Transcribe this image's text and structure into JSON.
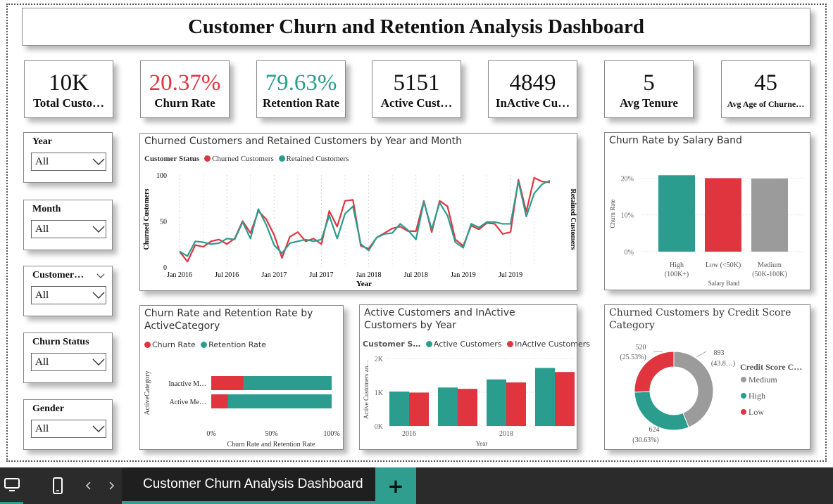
{
  "title": "Customer Churn and Retention Analysis Dashboard",
  "colors": {
    "churn": "#e0343f",
    "retention": "#2a9d8f",
    "gray": "#9b9b9b",
    "text": "#111111"
  },
  "kpis": [
    {
      "value": "10K",
      "label": "Total Custo…",
      "value_color": "#111111"
    },
    {
      "value": "20.37%",
      "label": "Churn Rate",
      "value_color": "#e0343f"
    },
    {
      "value": "79.63%",
      "label": "Retention Rate",
      "value_color": "#2a9d8f"
    },
    {
      "value": "5151",
      "label": "Active Cust…",
      "value_color": "#111111"
    },
    {
      "value": "4849",
      "label": "InActive Cu…",
      "value_color": "#111111"
    },
    {
      "value": "5",
      "label": "Avg Tenure",
      "value_color": "#111111"
    },
    {
      "value": "45",
      "label": "Avg Age of Churne…",
      "value_color": "#111111"
    }
  ],
  "slicers": [
    {
      "title": "Year",
      "value": "All"
    },
    {
      "title": "Month",
      "value": "All"
    },
    {
      "title": "Customer…",
      "value": "All"
    },
    {
      "title": "Churn Status",
      "value": "All"
    },
    {
      "title": "Gender",
      "value": "All"
    }
  ],
  "line_chart": {
    "title": "Churned Customers and Retained Customers by Year and Month",
    "legend_title": "Customer Status",
    "y_left_label": "Churned Customers",
    "y_right_label": "Retained Customers",
    "x_title": "Year",
    "y_ticks": [
      "100",
      "50",
      "0"
    ],
    "x_ticks": [
      "Jan 2016",
      "Jul 2016",
      "Jan 2017",
      "Jul 2017",
      "Jan 2018",
      "Jul 2018",
      "Jan 2019",
      "Jul 2019"
    ]
  },
  "salary_chart": {
    "title": "Churn Rate by Salary Band",
    "ylabel": "Churn Rate",
    "xlabel": "Salary Band",
    "y_ticks": [
      "20%",
      "10%",
      "0%"
    ],
    "cat_lines": [
      [
        "High",
        "(100K+)"
      ],
      [
        "Low (<50K)",
        ""
      ],
      [
        "Medium",
        "(50K-100K)"
      ]
    ]
  },
  "active_chart": {
    "title_line1": "Churn Rate and Retention Rate by",
    "title_line2": "ActiveCategory",
    "ylabel": "ActiveCategory",
    "xlabel": "Churn Rate and Retention Rate",
    "cat_labels": [
      "Inactive M…",
      "Active Me…"
    ],
    "x_ticks": [
      "0%",
      "50%",
      "100%"
    ]
  },
  "year_chart": {
    "title_line1": "Active Customers and InActive",
    "title_line2": "Customers by Year",
    "legend_title": "Customer S…",
    "ylabel": "Active Customers an…",
    "xlabel": "Year",
    "y_ticks": [
      "2K",
      "1K",
      "0K"
    ],
    "x_ticks": [
      "2016",
      "2018"
    ]
  },
  "donut_chart": {
    "title_line1": "Churned Customers by Credit Score",
    "title_line2": "Category",
    "legend_title": "Credit Score C…",
    "labels": {
      "low_count": "520",
      "low_pct": "(25.53%)",
      "med_count": "893",
      "med_pct": "(43.8…)",
      "high_count": "624",
      "high_pct": "(30.63%)"
    }
  },
  "chart_data": [
    {
      "type": "line",
      "title": "Churned Customers and Retained Customers by Year and Month",
      "xlabel": "Year",
      "ylabel": "Churned Customers",
      "ylim": [
        0,
        100
      ],
      "x": [
        "2016-01",
        "2016-02",
        "2016-03",
        "2016-04",
        "2016-05",
        "2016-06",
        "2016-07",
        "2016-08",
        "2016-09",
        "2016-10",
        "2016-11",
        "2016-12",
        "2017-01",
        "2017-02",
        "2017-03",
        "2017-04",
        "2017-05",
        "2017-06",
        "2017-07",
        "2017-08",
        "2017-09",
        "2017-10",
        "2017-11",
        "2017-12",
        "2018-01",
        "2018-02",
        "2018-03",
        "2018-04",
        "2018-05",
        "2018-06",
        "2018-07",
        "2018-08",
        "2018-09",
        "2018-10",
        "2018-11",
        "2018-12",
        "2019-01",
        "2019-02",
        "2019-03",
        "2019-04",
        "2019-05",
        "2019-06",
        "2019-07",
        "2019-08",
        "2019-09",
        "2019-10",
        "2019-11",
        "2019-12"
      ],
      "series": [
        {
          "name": "Churned Customers",
          "color": "#e0343f",
          "values": [
            17,
            6,
            24,
            22,
            28,
            30,
            25,
            31,
            50,
            37,
            61,
            52,
            35,
            10,
            33,
            38,
            28,
            31,
            25,
            61,
            44,
            72,
            73,
            23,
            20,
            32,
            37,
            42,
            44,
            39,
            39,
            72,
            38,
            72,
            66,
            30,
            23,
            45,
            41,
            48,
            47,
            36,
            38,
            95,
            60,
            97,
            93,
            92
          ]
        },
        {
          "name": "Retained Customers",
          "color": "#2a9d8f",
          "values": [
            17,
            12,
            28,
            27,
            25,
            26,
            31,
            30,
            49,
            31,
            63,
            46,
            24,
            15,
            26,
            28,
            30,
            28,
            30,
            56,
            31,
            58,
            66,
            25,
            18,
            32,
            36,
            37,
            47,
            40,
            30,
            71,
            41,
            70,
            56,
            27,
            21,
            47,
            43,
            49,
            49,
            47,
            47,
            93,
            55,
            80,
            90,
            94
          ]
        }
      ]
    },
    {
      "type": "bar",
      "title": "Churn Rate by Salary Band",
      "xlabel": "Salary Band",
      "ylabel": "Churn Rate",
      "ylim": [
        0,
        0.22
      ],
      "categories": [
        "High (100K+)",
        "Low (<50K)",
        "Medium (50K-100K)"
      ],
      "values": [
        0.208,
        0.2,
        0.199
      ],
      "colors": [
        "#2a9d8f",
        "#e0343f",
        "#9b9b9b"
      ]
    },
    {
      "type": "bar",
      "orientation": "horizontal",
      "stacked": true,
      "title": "Churn Rate and Retention Rate by ActiveCategory",
      "xlabel": "Churn Rate and Retention Rate",
      "ylabel": "ActiveCategory",
      "categories": [
        "Inactive M…",
        "Active Me…"
      ],
      "series": [
        {
          "name": "Churn Rate",
          "color": "#e0343f",
          "values": [
            0.27,
            0.14
          ]
        },
        {
          "name": "Retention Rate",
          "color": "#2a9d8f",
          "values": [
            0.73,
            0.86
          ]
        }
      ]
    },
    {
      "type": "bar",
      "title": "Active Customers and InActive Customers by Year",
      "xlabel": "Year",
      "ylabel": "Active Customers an…",
      "ylim": [
        0,
        2000
      ],
      "categories": [
        "2016",
        "2017",
        "2018",
        "2019"
      ],
      "series": [
        {
          "name": "Active Customers",
          "color": "#2a9d8f",
          "values": [
            1020,
            1140,
            1380,
            1720
          ]
        },
        {
          "name": "InActive Customers",
          "color": "#e0343f",
          "values": [
            990,
            1100,
            1290,
            1600
          ]
        }
      ]
    },
    {
      "type": "pie",
      "title": "Churned Customers by Credit Score Category",
      "categories": [
        "Medium",
        "High",
        "Low"
      ],
      "values": [
        893,
        624,
        520
      ],
      "colors": [
        "#9b9b9b",
        "#2a9d8f",
        "#e0343f"
      ]
    }
  ],
  "taskbar": {
    "tab_label": "Customer Churn Analysis Dashboard",
    "add_label": "+"
  }
}
